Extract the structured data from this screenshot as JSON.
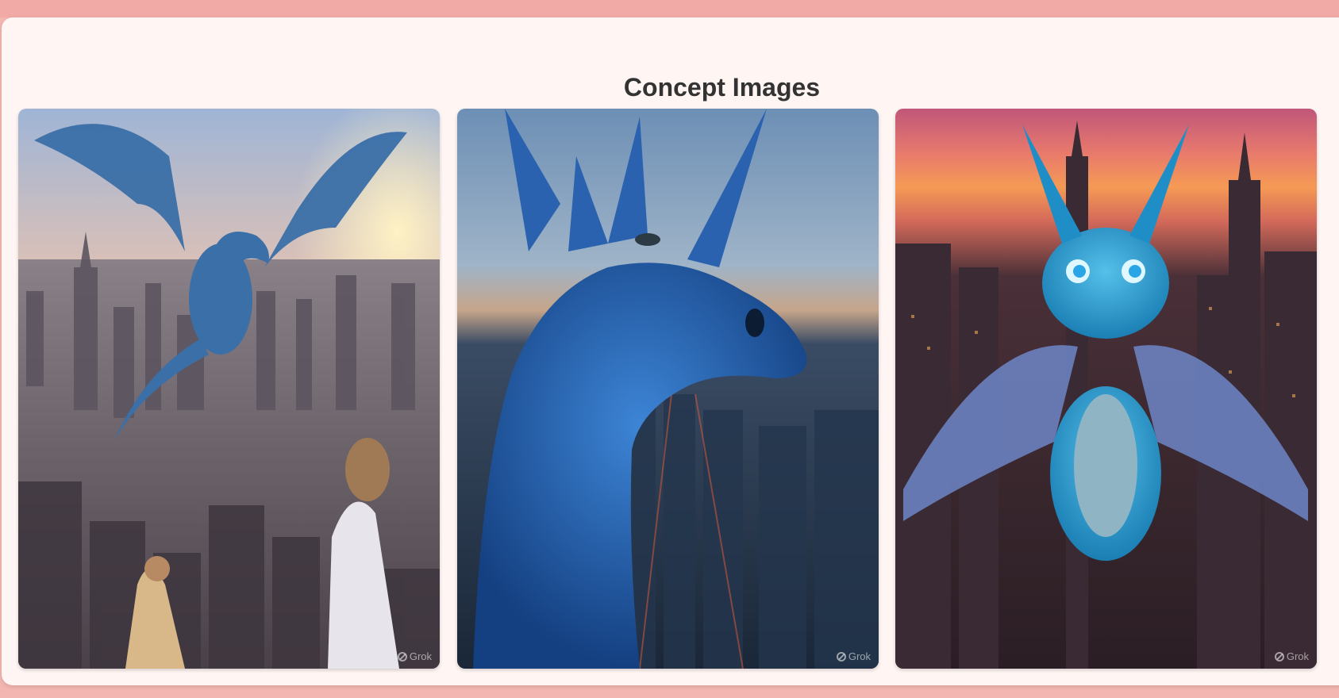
{
  "section": {
    "title": "Concept Images"
  },
  "images": [
    {
      "alt": "Blue dragon flying over a city skyline at sunset while two women watch from a rooftop",
      "watermark": "Grok",
      "palette": {
        "sky_top": "#9fb5d6",
        "sky_bottom": "#f6c28c",
        "city": "#6e6a72",
        "dragon": "#3a6fa8"
      }
    },
    {
      "alt": "Close-up of a blue dragon's head above a city at dusk",
      "watermark": "Grok",
      "palette": {
        "sky_top": "#6d8fb5",
        "sky_bottom": "#c6a58a",
        "city": "#1f3047",
        "dragon": "#1f5aa8"
      }
    },
    {
      "alt": "Cute cyan dragon hovering above a glowing city at sunset",
      "watermark": "Grok",
      "palette": {
        "sky_top": "#c0567a",
        "sky_bottom": "#f59a55",
        "city": "#3a2a33",
        "dragon": "#2aa5d6"
      }
    }
  ]
}
